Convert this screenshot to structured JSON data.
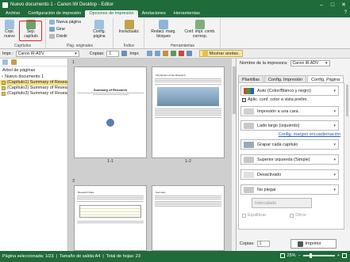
{
  "window": {
    "title": "Nuevo documento 1 - Canon iW Desktop - Editor",
    "minimize": "–",
    "maximize": "□",
    "close": "✕"
  },
  "menu": {
    "tabs": [
      "Archivo",
      "Configuración de impresión",
      "Opciones de impresión",
      "Anotaciones",
      "Herramientas"
    ],
    "active_index": 2,
    "help": "?"
  },
  "ribbon": {
    "copias": {
      "copia_nuevo": "Copi. nuevo",
      "sep_capitulo": "Sep. capítulo",
      "label": "Capítulos"
    },
    "pag_originales": {
      "nueva_pagina": "Nueva página",
      "girar": "Girar",
      "dividir": "Dividir",
      "config_pagina": "Config. página",
      "label": "Pág. originales"
    },
    "indice": {
      "ins_actualiz": "Ins/actualiz.",
      "label": "Índice"
    },
    "herramientas": {
      "redact": "Redact. marg. bloques",
      "conf_impr": "Conf. impr. comb. corresp.",
      "label": "Herramientas"
    }
  },
  "toolbar": {
    "impr_label": "Impr.:",
    "printer": "Canon iR-ADV",
    "copias_label": "Copias:",
    "copias_value": "1",
    "impr_btn": "Impr.",
    "mostrar": "Mostrar anotac."
  },
  "left_pane": {
    "title": "Árbol de páginas",
    "root": "Nuevo documento 1",
    "items": [
      "(Capítulo1) Summary of Resea",
      "(Capítulo2) Summary of Resea",
      "(Capítulo3) Summary of Resea"
    ]
  },
  "pages": [
    {
      "num": "1",
      "label": "1-1",
      "title": "Summary of Research"
    },
    {
      "num": "",
      "label": "1-2",
      "title": "Introduction of the Research"
    },
    {
      "num": "3",
      "label": "",
      "title": "Research Data"
    },
    {
      "num": "",
      "label": "",
      "title": "Summary"
    }
  ],
  "right_pane": {
    "printer_label": "Nombre de la impresora:",
    "printer_name": "Canon iR-ADV",
    "tabs": [
      "Plantillas",
      "Config. Impresión",
      "Config. Página"
    ],
    "active_tab": 2,
    "color": "Auto (Color/Blanco y negro)",
    "apply_check": "Aplic. conf. color a vista prelim.",
    "print_side": "Impresión a una cara",
    "binding": "Lado largo (izquierdo)",
    "margin_link": "Config. margen encuadernación",
    "staple": "Grapar cada capítulo",
    "staple_pos": "Superior izquierda (Simple)",
    "off": "Desactivado",
    "fold": "No plegar",
    "tapa": "Intercalado",
    "equilibrar": "Equilibrar",
    "otros": "Otros",
    "copias_label": "Copias:",
    "copias_value": "1",
    "print_btn": "Imprimir"
  },
  "status": {
    "page_sel": "Página seleccionada: 1/23",
    "size": "Tamaño de salida:A4",
    "total": "Total de hojas: 23",
    "zoom": "25%"
  }
}
